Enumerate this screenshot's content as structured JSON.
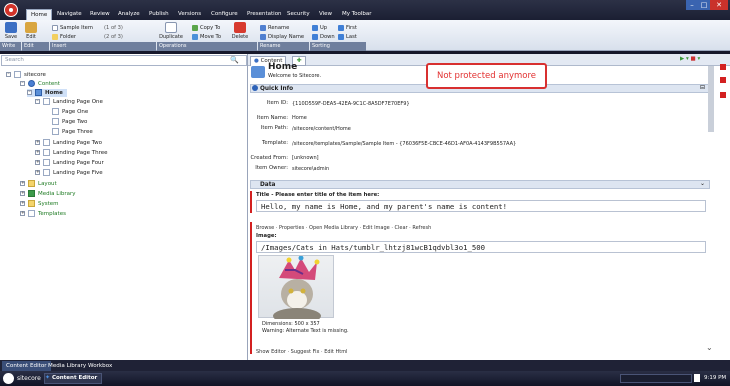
{
  "tabs": [
    "Home",
    "Navigate",
    "Review",
    "Analyze",
    "Publish",
    "Versions",
    "Configure",
    "Presentation",
    "Security",
    "View",
    "My Toolbar"
  ],
  "ribbon": {
    "save": "Save",
    "edit": "Edit",
    "sample_item": "Sample Item",
    "sample_count": "(1 of 3)",
    "folder": "Folder",
    "folder_count": "(2 of 3)",
    "duplicate": "Duplicate",
    "copy_to": "Copy To",
    "move_to": "Move To",
    "delete": "Delete",
    "rename": "Rename",
    "display_name": "Display Name",
    "up": "Up",
    "down": "Down",
    "first": "First",
    "last": "Last",
    "groups": [
      "Write",
      "Edit",
      "Insert",
      "Operations",
      "Rename",
      "Sorting"
    ]
  },
  "search": {
    "placeholder": "Search"
  },
  "tree": {
    "sitecore": "sitecore",
    "content": "Content",
    "home": "Home",
    "landing_one": "Landing Page One",
    "page_one": "Page One",
    "page_two": "Page Two",
    "page_three": "Page Three",
    "landing_two": "Landing Page Two",
    "landing_three": "Landing Page Three",
    "landing_four": "Landing Page Four",
    "landing_five": "Landing Page Five",
    "layout": "Layout",
    "media_library": "Media Library",
    "system": "System",
    "templates": "Templates"
  },
  "editor": {
    "tab": "Content",
    "title": "Home",
    "welcome": "Welcome to Sitecore.",
    "quick_info": "Quick Info",
    "item_id_label": "Item ID:",
    "item_id": "{110D559F-DEA5-42EA-9C1C-8A5DF7E70EF9}",
    "item_name_label": "Item Name:",
    "item_name": "Home",
    "item_path_label": "Item Path:",
    "item_path": "/sitecore/content/Home",
    "template_label": "Template:",
    "template": "/sitecore/templates/Sample/Sample Item - {76036F5E-CBCE-46D1-AF0A-4143F9B557AA}",
    "created_from_label": "Created From:",
    "created_from": "[unknown]",
    "item_owner_label": "Item Owner:",
    "item_owner": "sitecore\\admin",
    "data_section": "Data",
    "title_field_label": "Title - Please enter title of the item here:",
    "title_field_value": "Hello, my name is Home, and my parent's name is content!",
    "image_links": "Browse · Properties · Open Media Library · Edit Image · Clear · Refresh",
    "image_label": "Image:",
    "image_path": "/Images/Cats in Hats/tumblr_lhtzj81wcB1qdvbl3o1_500",
    "dimensions": "Dimensions: 500 x 357",
    "warning": "Warning: Alternate Text is missing.",
    "text_links": "Show Editor · Suggest Fix · Edit Html"
  },
  "callout": "Not protected anymore",
  "bottom_tabs": [
    "Content Editor",
    "Media Library",
    "Workbox"
  ],
  "taskbar": {
    "start": "sitecore",
    "app": "Content Editor",
    "time": "9:19 PM"
  }
}
